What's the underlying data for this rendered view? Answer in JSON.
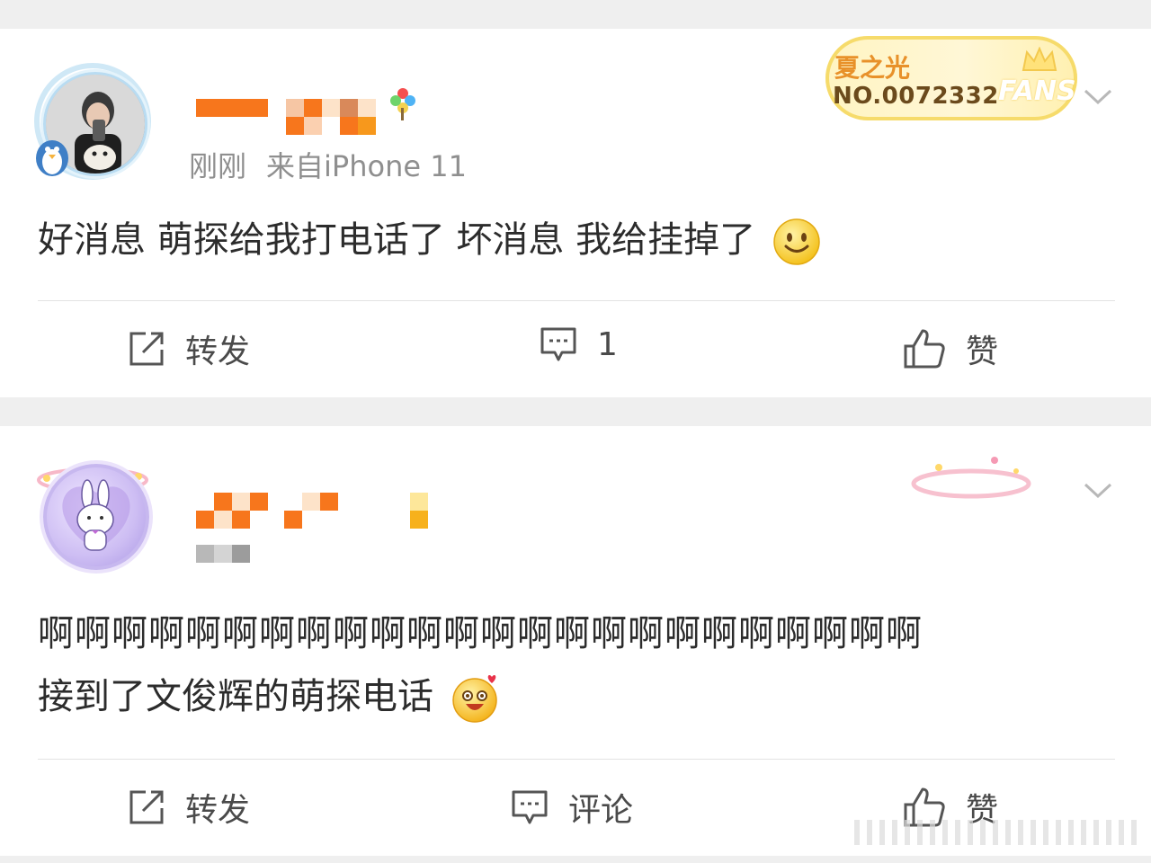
{
  "posts": [
    {
      "meta": {
        "time": "刚刚",
        "source": "来自iPhone 11"
      },
      "fan_badge": {
        "title": "夏之光",
        "number": "NO.0072332",
        "fans_label": "FANS"
      },
      "content": {
        "text": "好消息 萌探给我打电话了 坏消息 我给挂掉了",
        "emoji": "smile-emoji"
      },
      "actions": {
        "repost": "转发",
        "comment": "1",
        "like": "赞"
      }
    },
    {
      "content": {
        "line1": "啊啊啊啊啊啊啊啊啊啊啊啊啊啊啊啊啊啊啊啊啊啊啊啊",
        "line2": "接到了文俊辉的萌探电话",
        "emoji": "excited-emoji"
      },
      "actions": {
        "repost": "转发",
        "comment": "评论",
        "like": "赞"
      }
    }
  ],
  "colors": {
    "mosaic_orange": "#f7761c",
    "badge_gold": "#e8912a",
    "text": "#2c2c2c",
    "meta": "#8f8f8f"
  }
}
